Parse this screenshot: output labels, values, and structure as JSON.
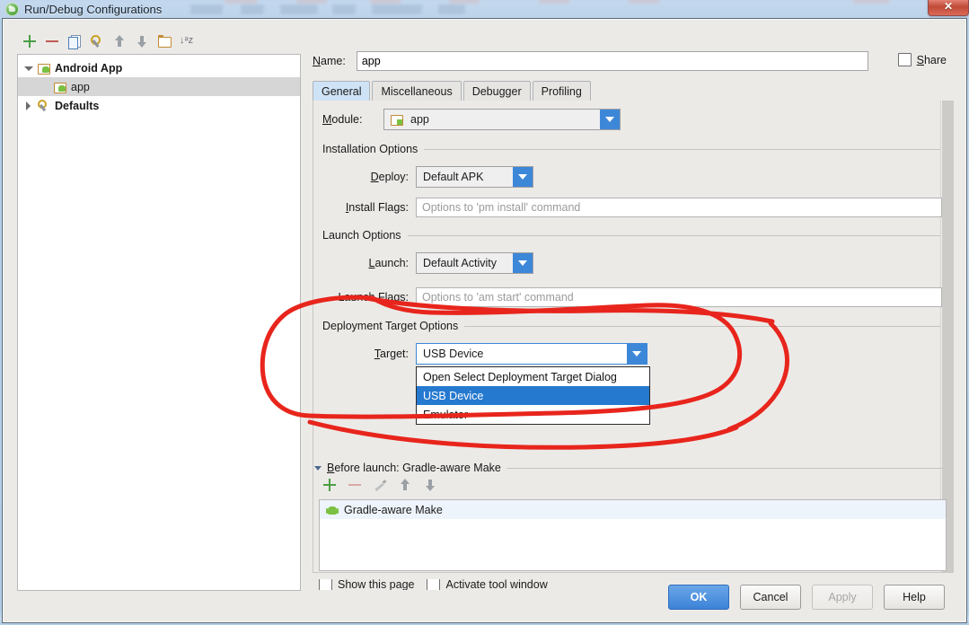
{
  "window": {
    "title": "Run/Debug Configurations",
    "logo_icon": "android-studio-icon",
    "close_label": "✕"
  },
  "toolbar": {
    "icons": [
      {
        "name": "add-icon",
        "label": "+"
      },
      {
        "name": "remove-icon",
        "label": "−"
      },
      {
        "name": "copy-configuration-icon",
        "label": "copy"
      },
      {
        "name": "edit-defaults-icon",
        "label": "wrench"
      },
      {
        "name": "move-up-icon",
        "label": "up"
      },
      {
        "name": "move-down-icon",
        "label": "down"
      },
      {
        "name": "folder-icon",
        "label": "folder"
      },
      {
        "name": "sort-alphabetically-icon",
        "label": "↓a\nz"
      }
    ],
    "sort_glyph": "↓ᵃz"
  },
  "tree": {
    "items": [
      {
        "label": "Android App",
        "bold": true,
        "expanded": true,
        "selected": false,
        "icon": "android-app-icon",
        "indent": 0
      },
      {
        "label": "app",
        "bold": false,
        "expanded": null,
        "selected": true,
        "icon": "android-app-icon",
        "indent": 1
      },
      {
        "label": "Defaults",
        "bold": true,
        "expanded": false,
        "selected": false,
        "icon": "wrench-icon",
        "indent": 0
      }
    ]
  },
  "name_field": {
    "label": "Name:",
    "label_mnemonic": "N",
    "value": "app"
  },
  "share": {
    "label": "Share",
    "checked": false
  },
  "tabs": [
    {
      "label": "General",
      "active": true
    },
    {
      "label": "Miscellaneous",
      "active": false
    },
    {
      "label": "Debugger",
      "active": false
    },
    {
      "label": "Profiling",
      "active": false
    }
  ],
  "general": {
    "module": {
      "label": "Module:",
      "value": "app",
      "icon": "module-icon"
    },
    "installation_options": {
      "section_title": "Installation Options",
      "deploy": {
        "label": "Deploy:",
        "value": "Default APK"
      },
      "install_flags": {
        "label": "Install Flags:",
        "value": "",
        "placeholder": "Options to 'pm install' command"
      }
    },
    "launch_options": {
      "section_title": "Launch Options",
      "launch": {
        "label": "Launch:",
        "value": "Default Activity"
      },
      "launch_flags": {
        "label": "Launch Flags:",
        "value": "",
        "placeholder": "Options to 'am start' command"
      }
    },
    "deployment_target_options": {
      "section_title": "Deployment Target Options",
      "target": {
        "label": "Target:",
        "value": "USB Device",
        "open": true,
        "options": [
          {
            "label": "Open Select Deployment Target Dialog",
            "selected": false
          },
          {
            "label": "USB Device",
            "selected": true
          },
          {
            "label": "Emulator",
            "selected": false
          }
        ]
      }
    },
    "before_launch": {
      "header": "Before launch: Gradle-aware Make",
      "toolbar_icons": [
        {
          "name": "add-task-icon",
          "label": "+"
        },
        {
          "name": "remove-task-icon",
          "label": "−"
        },
        {
          "name": "edit-task-icon",
          "label": "pencil"
        },
        {
          "name": "move-task-up-icon",
          "label": "up"
        },
        {
          "name": "move-task-down-icon",
          "label": "down"
        }
      ],
      "tasks": [
        {
          "label": "Gradle-aware Make",
          "icon": "android-robot-icon"
        }
      ]
    },
    "footer_checkboxes": [
      {
        "label": "Show this page",
        "checked": false
      },
      {
        "label": "Activate tool window",
        "checked": false
      }
    ]
  },
  "buttons": [
    {
      "label": "OK",
      "style": "primary",
      "enabled": true
    },
    {
      "label": "Cancel",
      "style": "normal",
      "enabled": true
    },
    {
      "label": "Apply",
      "style": "disabled",
      "enabled": false
    },
    {
      "label": "Help",
      "style": "normal",
      "enabled": true
    }
  ],
  "annotation": {
    "name": "red-ink-ellipse",
    "color": "#e8251c",
    "describes": "Deployment Target Options with open Target dropdown"
  },
  "colors": {
    "accent_blue": "#3d87d8",
    "selection_blue": "#2579cf",
    "dialog_bg": "#eceae7",
    "annotation_red": "#e8251c"
  }
}
